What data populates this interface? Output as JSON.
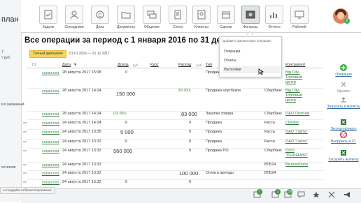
{
  "left": {
    "brand": "план",
    "frag1": "7",
    "frag2": "т руб.",
    "frag3": "в в указанный",
    "frag4": "остатков"
  },
  "nav": [
    {
      "label": "Задачи",
      "icon": "tasks-icon"
    },
    {
      "label": "Сотрудники",
      "icon": "employees-icon"
    },
    {
      "label": "Дела",
      "icon": "deals-icon"
    },
    {
      "label": "Документы",
      "icon": "documents-icon"
    },
    {
      "label": "Общение",
      "icon": "chat-icon"
    },
    {
      "label": "Счета",
      "icon": "invoices-icon"
    },
    {
      "label": "Клиенты",
      "icon": "clients-icon"
    },
    {
      "label": "Сделки",
      "icon": "handshake-icon"
    },
    {
      "label": "Финансы",
      "icon": "safe-icon"
    },
    {
      "label": "Отчеты",
      "icon": "reports-icon"
    },
    {
      "label": "Рабочий",
      "icon": "desktop-icon"
    }
  ],
  "avatar_badge": "2",
  "title": "Все операции за период с 1 января 2016 по 31 декабр",
  "range_button": "Точный диапазон▾",
  "range_text": "01.01.2016 — 31.12.2017",
  "headers": {
    "date": "Дата",
    "income": "Доход",
    "income_unit": "руб.",
    "rate": "Курс",
    "expense": "Расход",
    "expense_unit": "руб.",
    "type": "Тип",
    "counterparty": "Контрагент"
  },
  "rows": [
    {
      "id": "#240817001",
      "date": "28 августа 2017 15:08",
      "income": "0",
      "expense": "",
      "type": "Продажа ПО",
      "counterparty": "Big City-",
      "arrow": false,
      "incBig": false,
      "expBig": false
    },
    {
      "id": "#240817001",
      "date": "28 августа 2017 14:24",
      "income": "150 000",
      "expense": "(50 000)",
      "type": "Продажа ноутбуков",
      "account": "Сбербанк",
      "counterparty": "Big City-",
      "arrow": false,
      "incBig": true,
      "expBig": false
    },
    {
      "id": "#240817001",
      "date": "28 августа 2017 14:24",
      "income": "(26 000)",
      "expense": "83 000",
      "type": "Закупка товара",
      "account": "Сбербанк",
      "counterparty": "ОАО Охотник",
      "arrow": false,
      "incBig": false,
      "expBig": true
    },
    {
      "id": "#240817001",
      "date": "24 августа 2017 14:24",
      "income": "0",
      "expense": "0",
      "type": "Продажа",
      "account": "Касса",
      "counterparty": "Chester",
      "arrow": true,
      "incBig": false,
      "expBig": false
    },
    {
      "id": "#240817001",
      "date": "24 августа 2017 13:35",
      "income": "5 000",
      "expense": "0",
      "type": "Продажа",
      "account": "Касса",
      "counterparty": "ОАО \"Гайта\"",
      "arrow": true,
      "incBig": true,
      "expBig": false
    },
    {
      "id": "#240817001",
      "date": "24 августа 2017 13:32",
      "income": "0",
      "expense": "0",
      "type": "Продажа",
      "account": "Касса",
      "counterparty": "ОАО \"Гайта\"",
      "arrow": true,
      "incBig": false,
      "expBig": false
    },
    {
      "id": "#240817001",
      "date": "24 августа 2017 13:32",
      "income": "560 000",
      "expense": "0",
      "type": "Продажа ПО",
      "account": "Сбербанк",
      "counterparty": "ООО",
      "arrow": true,
      "incBig": true,
      "expBig": false
    },
    {
      "id": "#240817001",
      "date": "24 августа 2017 13:32",
      "income": "",
      "expense": "",
      "type": "",
      "account": "ВТБ24",
      "counterparty": "BiznessDone",
      "arrow": true,
      "incBig": false,
      "expBig": false
    },
    {
      "id": "#240817001",
      "date": "24 августа 2017 13:32",
      "income": "",
      "expense": "100 000",
      "type": "Оплата аренды",
      "account": "ВТБ24",
      "counterparty": "",
      "arrow": true,
      "incBig": false,
      "expBig": true
    },
    {
      "id": "#240817001",
      "date": "24 августа 2017 13:32",
      "income": "0",
      "expense": "0",
      "type": "",
      "account": "",
      "counterparty": "",
      "arrow": true,
      "incBig": false,
      "expBig": false
    }
  ],
  "counterparty_extra": {
    "r0a": "Торговый",
    "r0b": "центр",
    "r1a": "Торговый",
    "r1b": "центр",
    "r6b": "\"РЕШЕНИЯ\""
  },
  "dropdown": {
    "head": "Добавить финансовую операцию",
    "items": [
      "Операции",
      "Отчеты",
      "Настройки"
    ]
  },
  "right": [
    {
      "label": "Операция",
      "icon": "add-plus-icon"
    },
    {
      "label": "Удалить",
      "icon": "delete-icon"
    },
    {
      "label": "Загрузить в выписку",
      "icon": "upload-icon"
    },
    {
      "label": "Экспортировать",
      "icon": "export-excel-icon"
    },
    {
      "label": "Выгрузить в 1С",
      "icon": "export-1c-icon"
    },
    {
      "label": "Загрузить выписку",
      "icon": "upload-statement-icon"
    }
  ],
  "footer": {
    "url": "ru.megaplan.ru/finance/operations/",
    "badge1": "7",
    "badge2": "1",
    "badge3": "39"
  },
  "colors": {
    "accent": "#2f7d3a",
    "button_yellow": "#f6d55c"
  }
}
